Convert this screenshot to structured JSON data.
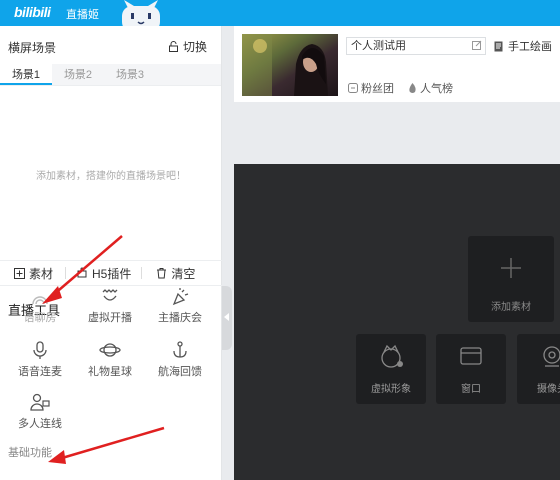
{
  "app": {
    "logo": "bilibili",
    "name": "直播姬"
  },
  "scene": {
    "title": "横屏场景",
    "switch_label": "切换",
    "tabs": [
      {
        "label": "场景1",
        "active": true
      },
      {
        "label": "场景2",
        "active": false
      },
      {
        "label": "场景3",
        "active": false
      }
    ],
    "empty_hint": "添加素材，搭建你的直播场景吧！"
  },
  "toolbar": {
    "material": "素材",
    "h5_plugin": "H5插件",
    "clear": "清空"
  },
  "live_tools": {
    "title": "直播工具",
    "items": [
      {
        "label": "语聊房",
        "icon": "voice-room-icon",
        "dim": true
      },
      {
        "label": "虚拟开播",
        "icon": "virtual-live-icon",
        "dim": false
      },
      {
        "label": "主播庆会",
        "icon": "celebration-icon",
        "dim": false
      },
      {
        "label": "语音连麦",
        "icon": "microphone-icon",
        "dim": false
      },
      {
        "label": "礼物星球",
        "icon": "gift-planet-icon",
        "dim": false
      },
      {
        "label": "航海回馈",
        "icon": "anchor-icon",
        "dim": false
      },
      {
        "label": "多人连线",
        "icon": "multi-user-icon",
        "dim": false
      }
    ]
  },
  "basic": {
    "title": "基础功能"
  },
  "room": {
    "title_value": "个人测试用",
    "category": "手工绘画",
    "links": {
      "fans": "粉丝团",
      "popularity": "人气榜"
    }
  },
  "preview": {
    "add_material": "添加素材",
    "sources": [
      {
        "label": "虚拟形象",
        "icon": "avatar-icon"
      },
      {
        "label": "窗口",
        "icon": "window-icon"
      },
      {
        "label": "摄像头",
        "icon": "camera-icon"
      }
    ]
  },
  "colors": {
    "brand": "#0fa4ea",
    "arrow": "#e02020",
    "preview_bg": "#2b2c2e"
  }
}
